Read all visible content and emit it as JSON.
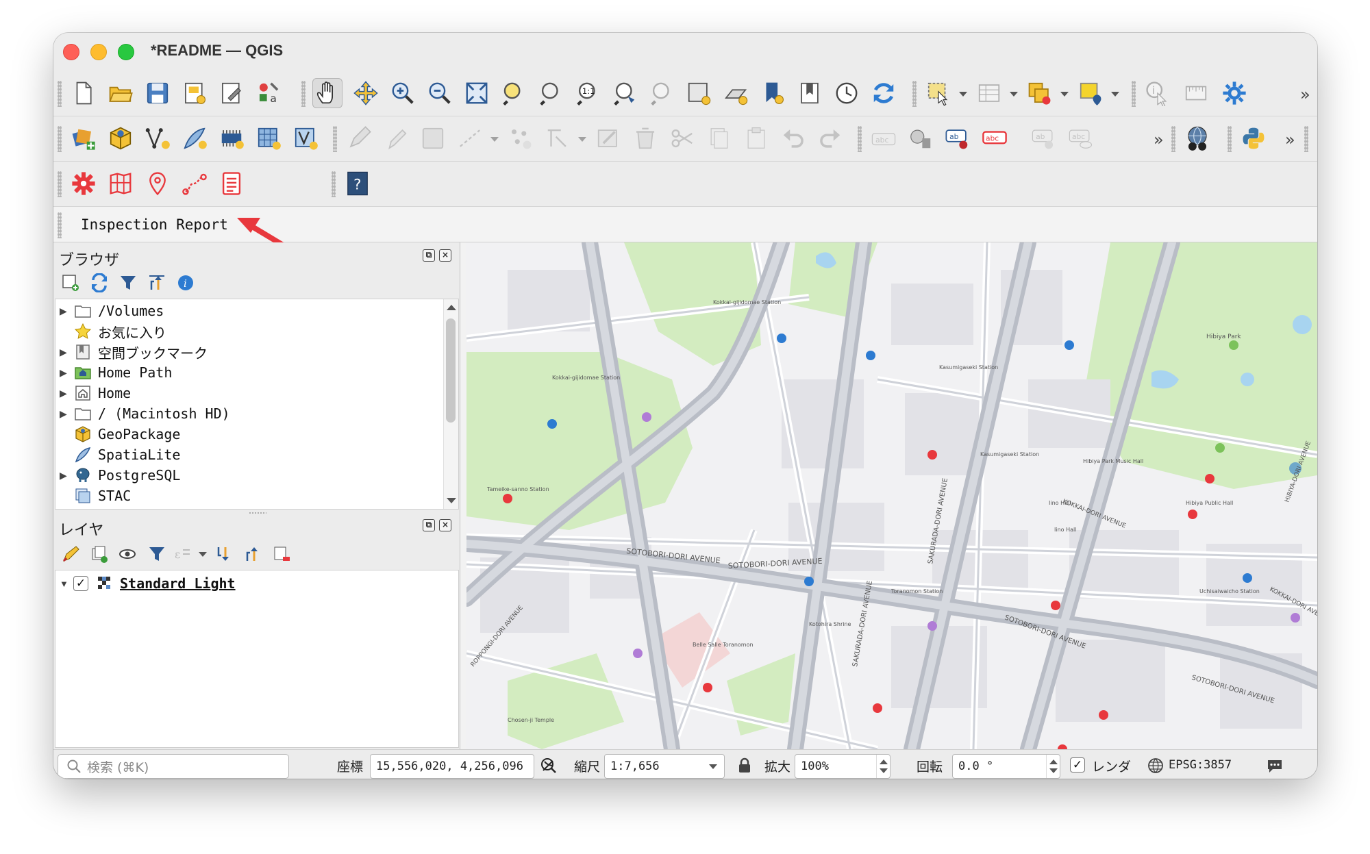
{
  "window": {
    "title": "*README — QGIS"
  },
  "toolbar4": {
    "inspection_report": "Inspection Report"
  },
  "browser": {
    "title": "ブラウザ",
    "items": [
      {
        "label": "/Volumes",
        "icon": "folder-icon",
        "expandable": true
      },
      {
        "label": "お気に入り",
        "icon": "star-icon",
        "expandable": false
      },
      {
        "label": "空間ブックマーク",
        "icon": "bookmark-icon",
        "expandable": true
      },
      {
        "label": "Home Path",
        "icon": "home-path-icon",
        "expandable": true
      },
      {
        "label": "Home",
        "icon": "home-icon",
        "expandable": true
      },
      {
        "label": "/ (Macintosh HD)",
        "icon": "folder-icon",
        "expandable": true
      },
      {
        "label": "GeoPackage",
        "icon": "geopackage-icon",
        "expandable": false
      },
      {
        "label": "SpatiaLite",
        "icon": "spatialite-icon",
        "expandable": false
      },
      {
        "label": "PostgreSQL",
        "icon": "postgresql-icon",
        "expandable": true
      },
      {
        "label": "STAC",
        "icon": "stac-icon",
        "expandable": false
      }
    ]
  },
  "layers": {
    "title": "レイヤ",
    "items": [
      {
        "label": "Standard Light",
        "checked": "✓"
      }
    ]
  },
  "map": {
    "labels": {
      "sotobori1": "SOTOBORI-DORI AVENUE",
      "sotobori2": "SOTOBORI-DORI AVENUE",
      "sotobori3": "SOTOBORI-DORI AVENUE",
      "sotobori4": "SOTOBORI-DORI AVENUE",
      "sakurada1": "SAKURADA-DORI AVENUE",
      "sakurada2": "SAKURADA-DORI AVENUE",
      "kokkai1": "KOKKAI-DORI AVENUE",
      "kokkai2": "KOKKAI-DORI AVENUE",
      "roppongi": "ROPPONGI-DORI AVENUE",
      "hibiya_ave": "HIBIYA-DORI AVENUE",
      "hibiya_park": "Hibiya Park",
      "kasumigaseki1": "Kasumigaseki Station",
      "kasumigaseki2": "Kasumigaseki Station",
      "kokkai_gijido1": "Kokkai-gijidomae Station",
      "kokkai_gijido2": "Kokkai-gijidomae Station",
      "toranomon": "Toranomon Station",
      "uchisaiwaicho": "Uchisaiwaicho Station",
      "iino_hall1": "Iino Hall",
      "iino_hall2": "Iino Hall",
      "hibiya_music": "Hibiya Park Music Hall",
      "hibiya_public": "Hibiya Public Hall",
      "kotohira": "Kotohira Shrine",
      "chosenji": "Chosen-ji Temple",
      "belle_salle": "Belle Salle Toranomon",
      "tameike": "Tameike-sanno Station"
    }
  },
  "status": {
    "search_placeholder": "検索 (⌘K)",
    "coord_label": "座標",
    "coord_value": "15,556,020, 4,256,096",
    "scale_label": "縮尺",
    "scale_value": "1:7,656",
    "magnifier_label": "拡大",
    "magnifier_value": "100%",
    "rotation_label": "回転",
    "rotation_value": "0.0 °",
    "render_label": "レンダ",
    "render_checked": "✓",
    "crs": "EPSG:3857"
  },
  "colors": {
    "accent_red": "#e8383d",
    "park_green": "#d3ecc0",
    "road_gray": "#b9bdc6",
    "map_bg": "#f1f1f3",
    "water_blue": "#a8d4f0"
  }
}
